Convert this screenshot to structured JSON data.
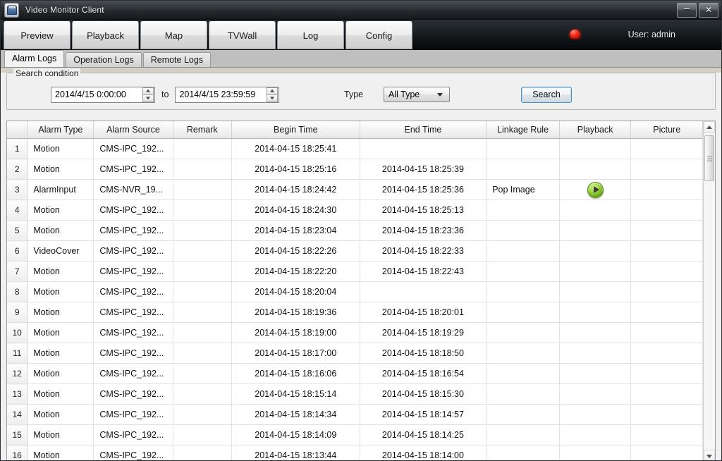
{
  "window": {
    "title": "Video Monitor Client",
    "app_icon": "video-camera-icon",
    "minimize_label": "–",
    "close_label": "✕"
  },
  "nav": {
    "buttons": [
      {
        "label": "Preview"
      },
      {
        "label": "Playback"
      },
      {
        "label": "Map"
      },
      {
        "label": "TVWall"
      },
      {
        "label": "Log"
      },
      {
        "label": "Config"
      }
    ],
    "alarm_icon": "alarm-lamp-icon",
    "user_label": "User: admin"
  },
  "subtabs": [
    {
      "label": "Alarm Logs",
      "active": true
    },
    {
      "label": "Operation Logs",
      "active": false
    },
    {
      "label": "Remote Logs",
      "active": false
    }
  ],
  "search": {
    "group_label": "Search condition",
    "start_time": "2014/4/15 0:00:00",
    "end_time": "2014/4/15 23:59:59",
    "to_label": "to",
    "type_label": "Type",
    "type_value": "All Type",
    "type_options": [
      "All Type"
    ],
    "search_button": "Search"
  },
  "table": {
    "index_header": "",
    "headers": [
      "Alarm Type",
      "Alarm Source",
      "Remark",
      "Begin Time",
      "End Time",
      "Linkage Rule",
      "Playback",
      "Picture"
    ],
    "rows": [
      {
        "index": "1",
        "alarm_type": "Motion",
        "alarm_source": "CMS-IPC_192...",
        "remark": "",
        "begin_time": "2014-04-15 18:25:41",
        "end_time": "",
        "linkage_rule": "",
        "playback": "",
        "picture": ""
      },
      {
        "index": "2",
        "alarm_type": "Motion",
        "alarm_source": "CMS-IPC_192...",
        "remark": "",
        "begin_time": "2014-04-15 18:25:16",
        "end_time": "2014-04-15 18:25:39",
        "linkage_rule": "",
        "playback": "",
        "picture": ""
      },
      {
        "index": "3",
        "alarm_type": "AlarmInput",
        "alarm_source": "CMS-NVR_19...",
        "remark": "",
        "begin_time": "2014-04-15 18:24:42",
        "end_time": "2014-04-15 18:25:36",
        "linkage_rule": "Pop Image",
        "playback": "play-icon",
        "picture": ""
      },
      {
        "index": "4",
        "alarm_type": "Motion",
        "alarm_source": "CMS-IPC_192...",
        "remark": "",
        "begin_time": "2014-04-15 18:24:30",
        "end_time": "2014-04-15 18:25:13",
        "linkage_rule": "",
        "playback": "",
        "picture": ""
      },
      {
        "index": "5",
        "alarm_type": "Motion",
        "alarm_source": "CMS-IPC_192...",
        "remark": "",
        "begin_time": "2014-04-15 18:23:04",
        "end_time": "2014-04-15 18:23:36",
        "linkage_rule": "",
        "playback": "",
        "picture": ""
      },
      {
        "index": "6",
        "alarm_type": "VideoCover",
        "alarm_source": "CMS-IPC_192...",
        "remark": "",
        "begin_time": "2014-04-15 18:22:26",
        "end_time": "2014-04-15 18:22:33",
        "linkage_rule": "",
        "playback": "",
        "picture": ""
      },
      {
        "index": "7",
        "alarm_type": "Motion",
        "alarm_source": "CMS-IPC_192...",
        "remark": "",
        "begin_time": "2014-04-15 18:22:20",
        "end_time": "2014-04-15 18:22:43",
        "linkage_rule": "",
        "playback": "",
        "picture": ""
      },
      {
        "index": "8",
        "alarm_type": "Motion",
        "alarm_source": "CMS-IPC_192...",
        "remark": "",
        "begin_time": "2014-04-15 18:20:04",
        "end_time": "",
        "linkage_rule": "",
        "playback": "",
        "picture": ""
      },
      {
        "index": "9",
        "alarm_type": "Motion",
        "alarm_source": "CMS-IPC_192...",
        "remark": "",
        "begin_time": "2014-04-15 18:19:36",
        "end_time": "2014-04-15 18:20:01",
        "linkage_rule": "",
        "playback": "",
        "picture": ""
      },
      {
        "index": "10",
        "alarm_type": "Motion",
        "alarm_source": "CMS-IPC_192...",
        "remark": "",
        "begin_time": "2014-04-15 18:19:00",
        "end_time": "2014-04-15 18:19:29",
        "linkage_rule": "",
        "playback": "",
        "picture": ""
      },
      {
        "index": "11",
        "alarm_type": "Motion",
        "alarm_source": "CMS-IPC_192...",
        "remark": "",
        "begin_time": "2014-04-15 18:17:00",
        "end_time": "2014-04-15 18:18:50",
        "linkage_rule": "",
        "playback": "",
        "picture": ""
      },
      {
        "index": "12",
        "alarm_type": "Motion",
        "alarm_source": "CMS-IPC_192...",
        "remark": "",
        "begin_time": "2014-04-15 18:16:06",
        "end_time": "2014-04-15 18:16:54",
        "linkage_rule": "",
        "playback": "",
        "picture": ""
      },
      {
        "index": "13",
        "alarm_type": "Motion",
        "alarm_source": "CMS-IPC_192...",
        "remark": "",
        "begin_time": "2014-04-15 18:15:14",
        "end_time": "2014-04-15 18:15:30",
        "linkage_rule": "",
        "playback": "",
        "picture": ""
      },
      {
        "index": "14",
        "alarm_type": "Motion",
        "alarm_source": "CMS-IPC_192...",
        "remark": "",
        "begin_time": "2014-04-15 18:14:34",
        "end_time": "2014-04-15 18:14:57",
        "linkage_rule": "",
        "playback": "",
        "picture": ""
      },
      {
        "index": "15",
        "alarm_type": "Motion",
        "alarm_source": "CMS-IPC_192...",
        "remark": "",
        "begin_time": "2014-04-15 18:14:09",
        "end_time": "2014-04-15 18:14:25",
        "linkage_rule": "",
        "playback": "",
        "picture": ""
      },
      {
        "index": "16",
        "alarm_type": "Motion",
        "alarm_source": "CMS-IPC_192...",
        "remark": "",
        "begin_time": "2014-04-15 18:13:44",
        "end_time": "2014-04-15 18:14:00",
        "linkage_rule": "",
        "playback": "",
        "picture": ""
      }
    ]
  },
  "colors": {
    "titlebar_dark": "#15181b",
    "navbar_dark": "#0e1215",
    "panel_bg": "#f0f0f0",
    "accent_blue": "#4a93c9",
    "alarm_red": "#f02a18",
    "play_green": "#9fd641"
  }
}
